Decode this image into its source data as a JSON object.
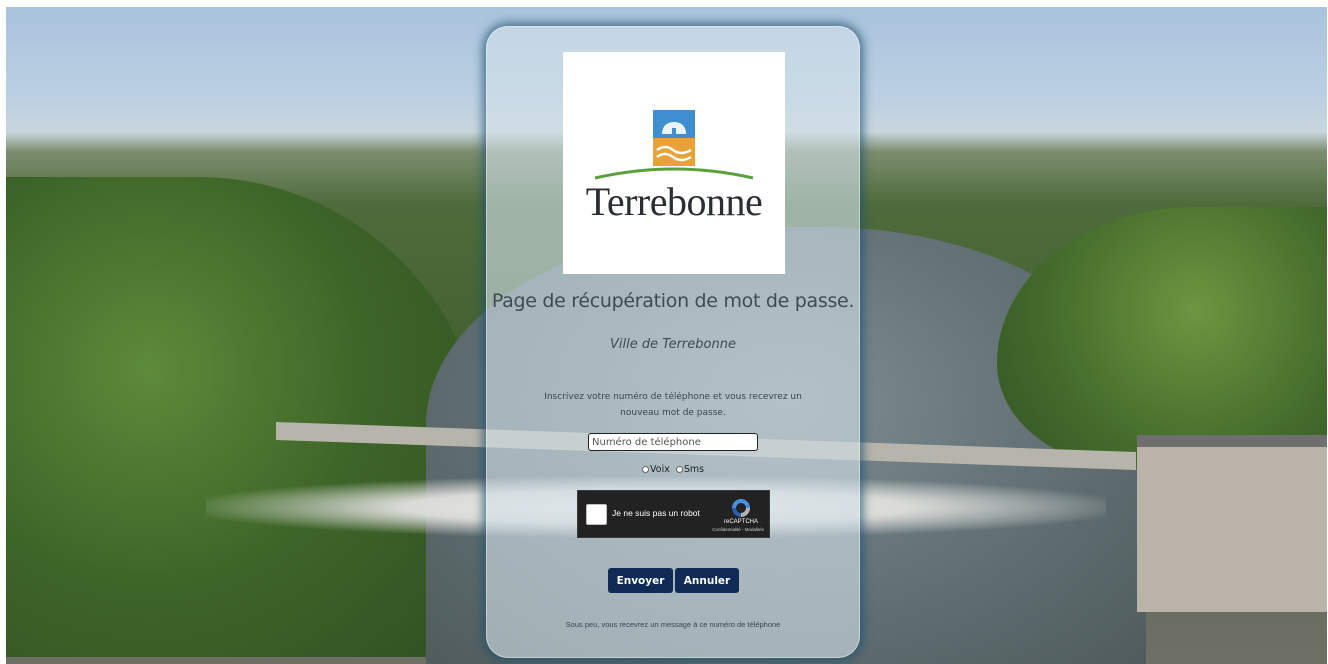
{
  "logo": {
    "name": "Terrebonne",
    "emblem_icon": "terrebonne-emblem-icon",
    "colors": {
      "sky": "#3e8ed0",
      "gold": "#e7a23a",
      "green": "#5aa13b",
      "text": "#2b2f33"
    }
  },
  "page": {
    "title": "Page de récupération de mot de passe.",
    "subtitle": "Ville de Terrebonne",
    "instructions": "Inscrivez votre numéro de téléphone et vous recevrez un nouveau mot de passe."
  },
  "form": {
    "phone_placeholder": "Numéro de téléphone",
    "phone_value": "",
    "delivery_options": [
      {
        "label": "Voix",
        "selected": false
      },
      {
        "label": "Sms",
        "selected": false
      }
    ]
  },
  "captcha": {
    "label": "Je ne suis pas un robot",
    "brand": "reCAPTCHA",
    "links": "Confidentialité - Modalités",
    "icon": "recaptcha-icon",
    "checked": false
  },
  "buttons": {
    "send_label": "Envoyer",
    "cancel_label": "Annuler",
    "color": "#0f2a55"
  },
  "footer": {
    "note": "Sous peu, vous recevrez un message à ce numéro de téléphone"
  }
}
